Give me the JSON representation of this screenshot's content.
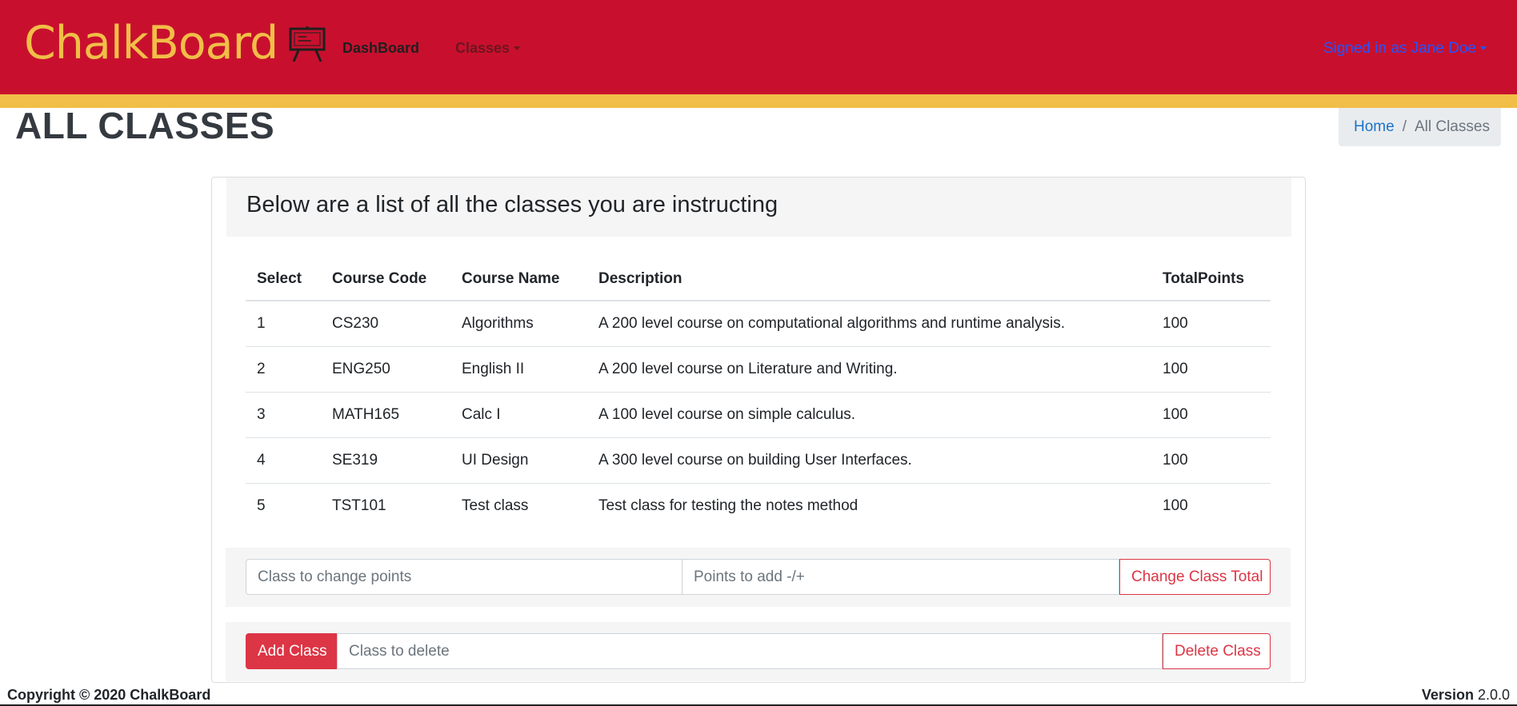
{
  "navbar": {
    "brand": "ChalkBoard",
    "brand_icon": "chalkboard-easel-icon",
    "links": [
      {
        "label": "DashBoard"
      },
      {
        "label": "Classes"
      }
    ],
    "user_menu": "Signed in as Jane Doe",
    "colors": {
      "primary": "#c8102e",
      "accent": "#f1be48"
    }
  },
  "page": {
    "title": "ALL CLASSES",
    "breadcrumb": {
      "home": "Home",
      "sep": "/",
      "current": "All Classes"
    }
  },
  "card": {
    "header": "Below are a list of all the classes you are instructing",
    "table": {
      "columns": [
        "Select",
        "Course Code",
        "Course Name",
        "Description",
        "TotalPoints"
      ],
      "rows": [
        [
          "1",
          "CS230",
          "Algorithms",
          "A 200 level course on computational algorithms and runtime analysis.",
          "100"
        ],
        [
          "2",
          "ENG250",
          "English II",
          "A 200 level course on Literature and Writing.",
          "100"
        ],
        [
          "3",
          "MATH165",
          "Calc I",
          "A 100 level course on simple calculus.",
          "100"
        ],
        [
          "4",
          "SE319",
          "UI Design",
          "A 300 level course on building User Interfaces.",
          "100"
        ],
        [
          "5",
          "TST101",
          "Test class",
          "Test class for testing the notes method",
          "100"
        ]
      ]
    },
    "points_form": {
      "class_placeholder": "Class to change points",
      "points_placeholder": "Points to add -/+",
      "submit_label": "Change Class Total"
    },
    "class_form": {
      "add_label": "Add Class",
      "delete_placeholder": "Class to delete",
      "delete_label": "Delete Class"
    }
  },
  "footer": {
    "copyright": "Copyright © 2020 ChalkBoard",
    "version_label": "Version",
    "version_number": "2.0.0"
  }
}
